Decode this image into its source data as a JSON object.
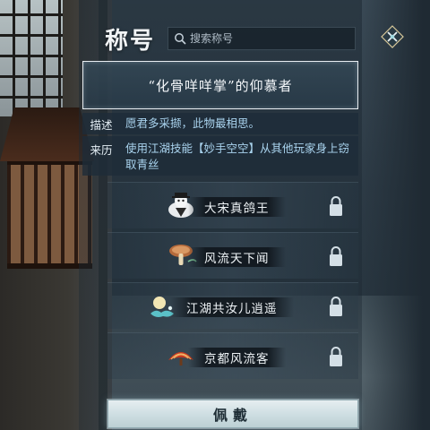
{
  "header": {
    "title": "称号",
    "search_placeholder": "搜索称号"
  },
  "selected_title": {
    "name": "“化骨咩咩掌”的仰慕者"
  },
  "details": {
    "desc_label": "描述",
    "desc_text": "愿君多采撷，此物最相思。",
    "source_label": "来历",
    "source_text": "使用江湖技能【妙手空空】从其他玩家身上窃取青丝"
  },
  "list": [
    {
      "label": "大宋真鸽王",
      "icon": "pigeon-icon",
      "locked": true
    },
    {
      "label": "风流天下闻",
      "icon": "mushroom-fan-icon",
      "locked": true
    },
    {
      "label": "江湖共汝儿逍遥",
      "icon": "moon-cloud-icon",
      "locked": true
    },
    {
      "label": "京都风流客",
      "icon": "red-fan-icon",
      "locked": true
    }
  ],
  "wear_button": {
    "label": "佩戴"
  },
  "colors": {
    "accent_text": "#a9d3ee",
    "banner_border": "#e9eef2",
    "button_face": "#cfdfe3"
  }
}
